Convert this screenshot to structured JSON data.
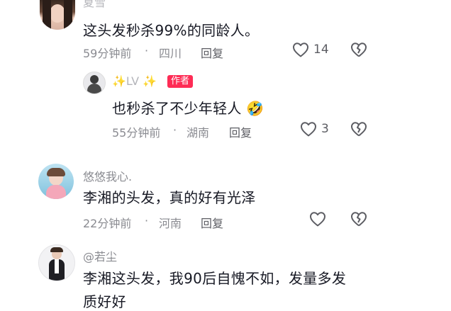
{
  "comments": [
    {
      "username": "夏雪",
      "text": "这头发秒杀99%的同龄人。",
      "time": "59分钟前",
      "location": "四川",
      "reply_label": "回复",
      "likes": "14"
    },
    {
      "username": "✨LV",
      "author_badge": "作者",
      "text": "也秒杀了不少年轻人",
      "time": "55分钟前",
      "location": "湖南",
      "reply_label": "回复",
      "likes": "3"
    },
    {
      "username": "悠悠我心.",
      "text": "李湘的头发，真的好有光泽",
      "time": "22分钟前",
      "location": "河南",
      "reply_label": "回复"
    },
    {
      "username": "@若尘",
      "text_line1": "李湘这头发，我90后自愧不如，发量多发",
      "text_line2": "质好好"
    }
  ],
  "separator": "·",
  "colors": {
    "author_badge": "#fe2c55",
    "meta": "#8a8b91",
    "text": "#161823"
  },
  "icons": [
    "heart-outline-icon",
    "broken-heart-icon",
    "laughing-emoji-icon",
    "sparkles-icon"
  ]
}
